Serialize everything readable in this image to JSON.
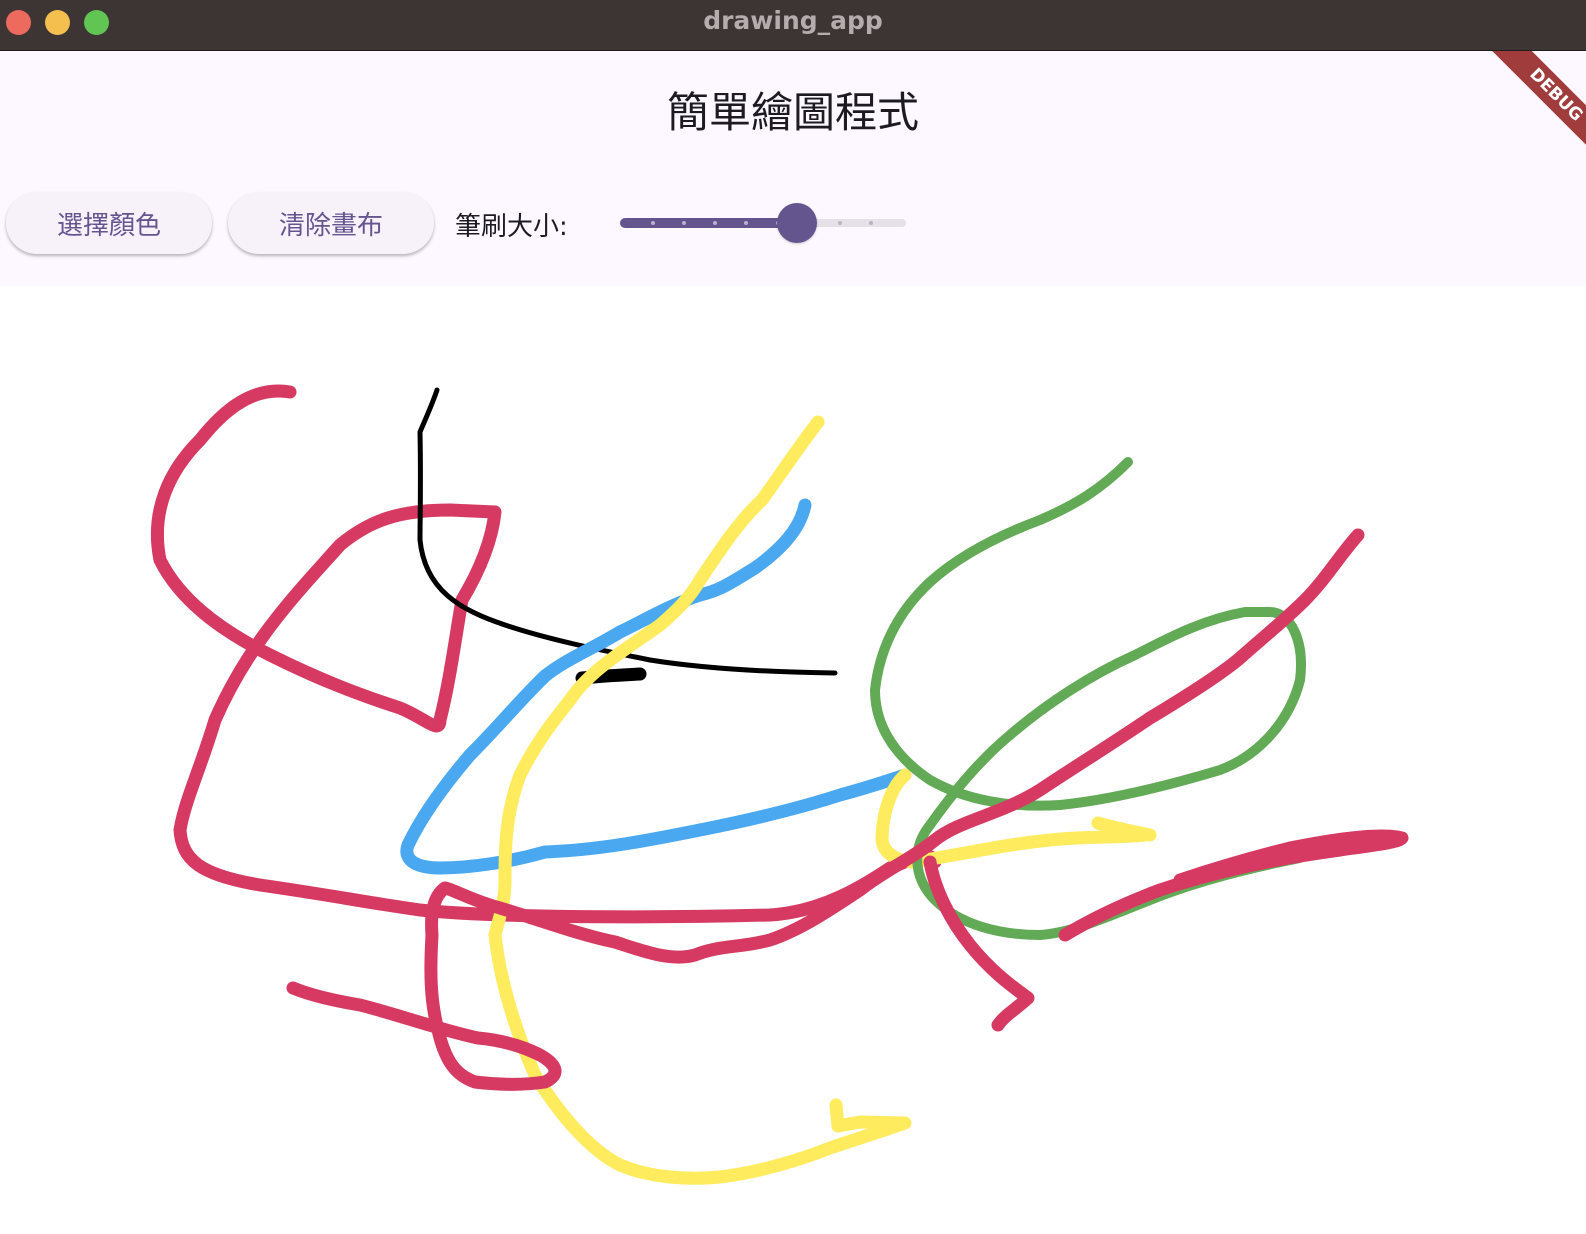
{
  "window": {
    "title": "drawing_app",
    "controls": [
      "close",
      "minimize",
      "maximize"
    ]
  },
  "app_bar": {
    "title": "簡單繪圖程式"
  },
  "debug_banner": "DEBUG",
  "toolbar": {
    "pick_color_label": "選擇顏色",
    "clear_canvas_label": "清除畫布",
    "brush_size_label": "筆刷大小:",
    "brush_size_slider": {
      "fraction": 0.66,
      "divisions": 9
    }
  },
  "colors": {
    "accent": "#65558f",
    "background": "#fdf7ff",
    "titlebar": "#3d3434",
    "stroke_red": "#d63a62",
    "stroke_black": "#000000",
    "stroke_blue": "#4aa8f0",
    "stroke_yellow": "#ffeb5e",
    "stroke_green": "#63aa57"
  },
  "canvas": {
    "strokes": [
      {
        "color": "#d63a62",
        "width": 13
      },
      {
        "color": "#000000",
        "width": 5
      },
      {
        "color": "#000000",
        "width": 13
      },
      {
        "color": "#4aa8f0",
        "width": 13
      },
      {
        "color": "#ffeb5e",
        "width": 13
      },
      {
        "color": "#ffeb5e",
        "width": 13
      },
      {
        "color": "#63aa57",
        "width": 10
      },
      {
        "color": "#d63a62",
        "width": 13
      }
    ]
  }
}
